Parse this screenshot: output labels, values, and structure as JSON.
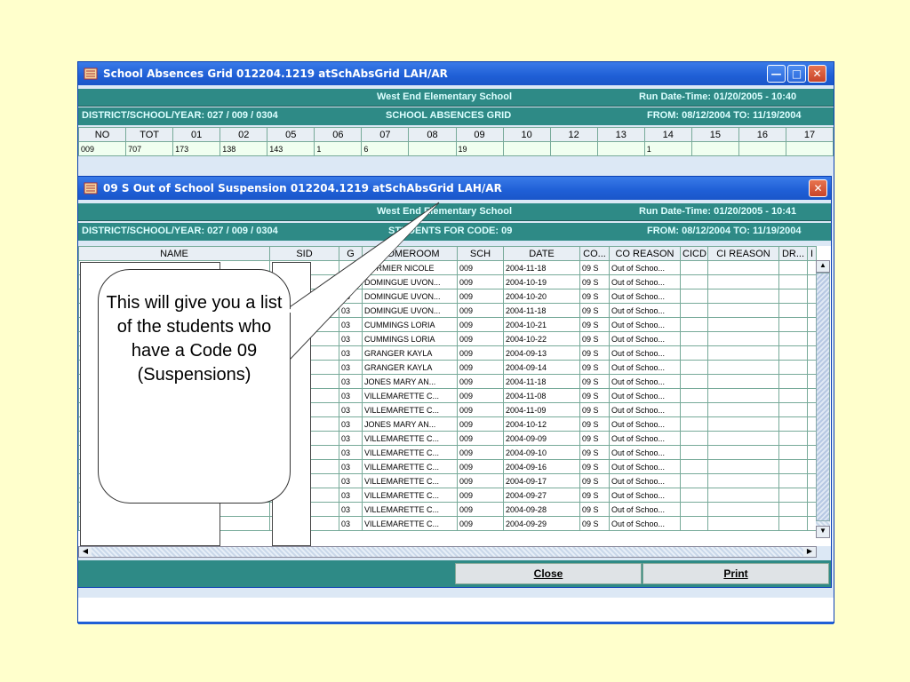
{
  "back_window": {
    "title": "School Absences Grid   012204.1219 atSchAbsGrid LAH/AR",
    "school": "West End Elementary School",
    "run_date": "Run Date-Time: 01/20/2005  -  10:40",
    "district": "DISTRICT/SCHOOL/YEAR: 027 / 009 / 0304",
    "grid_title": "SCHOOL ABSENCES GRID",
    "from_to": "FROM: 08/12/2004 TO: 11/19/2004",
    "columns": [
      "NO",
      "TOT",
      "01",
      "02",
      "05",
      "06",
      "07",
      "08",
      "09",
      "10",
      "12",
      "13",
      "14",
      "15",
      "16",
      "17"
    ],
    "row": [
      "009",
      "707",
      "173",
      "138",
      "143",
      "1",
      "6",
      "",
      "19",
      "",
      "",
      "",
      "1",
      "",
      "",
      ""
    ]
  },
  "front_window": {
    "title": "09 S Out of School Suspension   012204.1219 atSchAbsGrid LAH/AR",
    "school": "West End Elementary School",
    "run_date": "Run Date-Time: 01/20/2005  -  10:41",
    "district": "DISTRICT/SCHOOL/YEAR: 027 / 009 / 0304",
    "grid_title": "STUDENTS FOR CODE: 09",
    "from_to": "FROM: 08/12/2004 TO: 11/19/2004",
    "columns": [
      "NAME",
      "SID",
      "G",
      "HOMEROOM",
      "SCH",
      "DATE",
      "CO...",
      "CO REASON",
      "CICD",
      "CI REASON",
      "DR...",
      "I"
    ],
    "rows": [
      [
        "",
        "",
        "",
        "CORMIER NICOLE",
        "009",
        "2004-11-18",
        "09 S",
        "Out of Schoo..."
      ],
      [
        "",
        "",
        "",
        "DOMINGUE UVON...",
        "009",
        "2004-10-19",
        "09 S",
        "Out of Schoo..."
      ],
      [
        "",
        "",
        "03",
        "DOMINGUE UVON...",
        "009",
        "2004-10-20",
        "09 S",
        "Out of Schoo..."
      ],
      [
        "",
        "",
        "03",
        "DOMINGUE UVON...",
        "009",
        "2004-11-18",
        "09 S",
        "Out of Schoo..."
      ],
      [
        "",
        "",
        "03",
        "CUMMINGS LORIA",
        "009",
        "2004-10-21",
        "09 S",
        "Out of Schoo..."
      ],
      [
        "",
        "",
        "03",
        "CUMMINGS LORIA",
        "009",
        "2004-10-22",
        "09 S",
        "Out of Schoo..."
      ],
      [
        "",
        "",
        "03",
        "GRANGER KAYLA",
        "009",
        "2004-09-13",
        "09 S",
        "Out of Schoo..."
      ],
      [
        "",
        "",
        "03",
        "GRANGER KAYLA",
        "009",
        "2004-09-14",
        "09 S",
        "Out of Schoo..."
      ],
      [
        "",
        "",
        "03",
        "JONES MARY AN...",
        "009",
        "2004-11-18",
        "09 S",
        "Out of Schoo..."
      ],
      [
        "",
        "",
        "03",
        "VILLEMARETTE C...",
        "009",
        "2004-11-08",
        "09 S",
        "Out of Schoo..."
      ],
      [
        "",
        "",
        "03",
        "VILLEMARETTE C...",
        "009",
        "2004-11-09",
        "09 S",
        "Out of Schoo..."
      ],
      [
        "",
        "",
        "03",
        "JONES MARY AN...",
        "009",
        "2004-10-12",
        "09 S",
        "Out of Schoo..."
      ],
      [
        "",
        "",
        "03",
        "VILLEMARETTE C...",
        "009",
        "2004-09-09",
        "09 S",
        "Out of Schoo..."
      ],
      [
        "",
        "",
        "03",
        "VILLEMARETTE C...",
        "009",
        "2004-09-10",
        "09 S",
        "Out of Schoo..."
      ],
      [
        "",
        "",
        "03",
        "VILLEMARETTE C...",
        "009",
        "2004-09-16",
        "09 S",
        "Out of Schoo..."
      ],
      [
        "",
        "",
        "03",
        "VILLEMARETTE C...",
        "009",
        "2004-09-17",
        "09 S",
        "Out of Schoo..."
      ],
      [
        "",
        "",
        "03",
        "VILLEMARETTE C...",
        "009",
        "2004-09-27",
        "09 S",
        "Out of Schoo..."
      ],
      [
        "",
        "",
        "03",
        "VILLEMARETTE C...",
        "009",
        "2004-09-28",
        "09 S",
        "Out of Schoo..."
      ],
      [
        "",
        "",
        "03",
        "VILLEMARETTE C...",
        "009",
        "2004-09-29",
        "09 S",
        "Out of Schoo..."
      ]
    ],
    "close_label": "Close",
    "print_label": "Print"
  },
  "callout_text": "This will give you a list of the students who have a Code 09 (Suspensions)",
  "colors": {
    "title_blue": "#1f5fd6",
    "teal_band": "#2e8a86",
    "slide_bg": "#ffffcc"
  }
}
